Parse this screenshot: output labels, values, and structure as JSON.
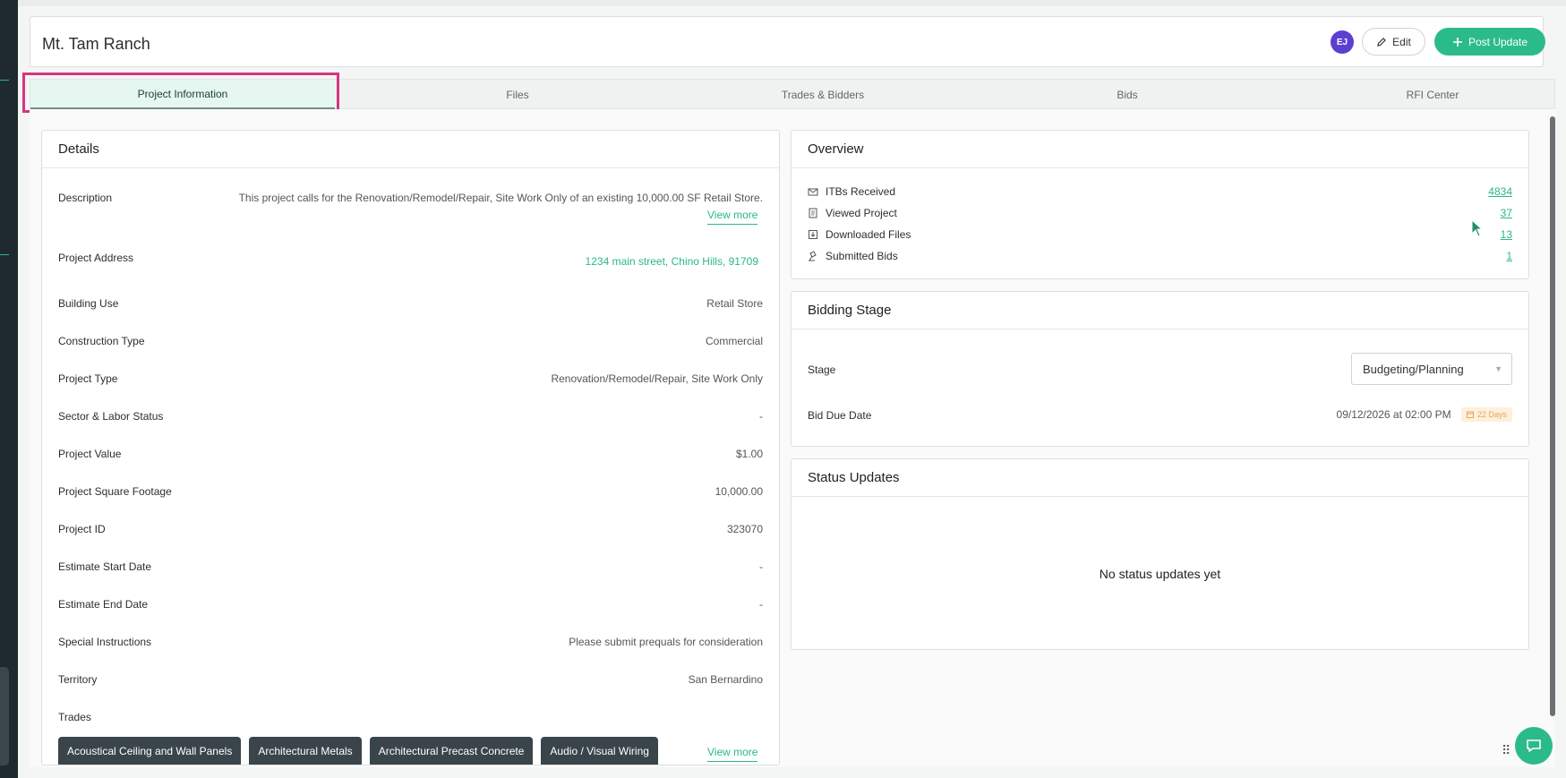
{
  "header": {
    "title": "Mt. Tam Ranch",
    "avatar_initials": "EJ",
    "edit_label": "Edit",
    "post_label": "Post Update"
  },
  "tabs": [
    {
      "label": "Project Information"
    },
    {
      "label": "Files"
    },
    {
      "label": "Trades & Bidders"
    },
    {
      "label": "Bids"
    },
    {
      "label": "RFI Center"
    }
  ],
  "details": {
    "title": "Details",
    "view_more": "View more",
    "rows": [
      {
        "label": "Description",
        "value": "This project calls for the Renovation/Remodel/Repair, Site Work Only of an existing 10,000.00 SF Retail Store."
      },
      {
        "label": "Project Address",
        "value": "1234 main street, Chino Hills, 91709"
      },
      {
        "label": "Building Use",
        "value": "Retail Store"
      },
      {
        "label": "Construction Type",
        "value": "Commercial"
      },
      {
        "label": "Project Type",
        "value": "Renovation/Remodel/Repair, Site Work Only"
      },
      {
        "label": "Sector & Labor Status",
        "value": "-"
      },
      {
        "label": "Project Value",
        "value": "$1.00"
      },
      {
        "label": "Project Square Footage",
        "value": "10,000.00"
      },
      {
        "label": "Project ID",
        "value": "323070"
      },
      {
        "label": "Estimate Start Date",
        "value": "-"
      },
      {
        "label": "Estimate End Date",
        "value": "-"
      },
      {
        "label": "Special Instructions",
        "value": "Please submit prequals for consideration"
      },
      {
        "label": "Territory",
        "value": "San Bernardino"
      },
      {
        "label": "Trades",
        "value": ""
      }
    ],
    "trades": [
      "Acoustical Ceiling and Wall Panels",
      "Architectural Metals",
      "Architectural Precast Concrete",
      "Audio / Visual Wiring"
    ],
    "trades_view_more": "View more"
  },
  "overview": {
    "title": "Overview",
    "rows": [
      {
        "label": "ITBs Received",
        "value": "4834",
        "icon": "envelope-icon"
      },
      {
        "label": "Viewed Project",
        "value": "37",
        "icon": "document-icon"
      },
      {
        "label": "Downloaded Files",
        "value": "13",
        "icon": "download-icon"
      },
      {
        "label": "Submitted Bids",
        "value": "1",
        "icon": "gavel-icon"
      }
    ]
  },
  "bidding": {
    "title": "Bidding Stage",
    "stage_label": "Stage",
    "stage_value": "Budgeting/Planning",
    "due_label": "Bid Due Date",
    "due_value": "09/12/2026 at 02:00 PM",
    "days_badge": "22 Days"
  },
  "status": {
    "title": "Status Updates",
    "empty_text": "No status updates yet"
  },
  "colors": {
    "accent": "#2bbb8a",
    "avatar": "#5b3fd1",
    "highlight": "#d6357f"
  }
}
